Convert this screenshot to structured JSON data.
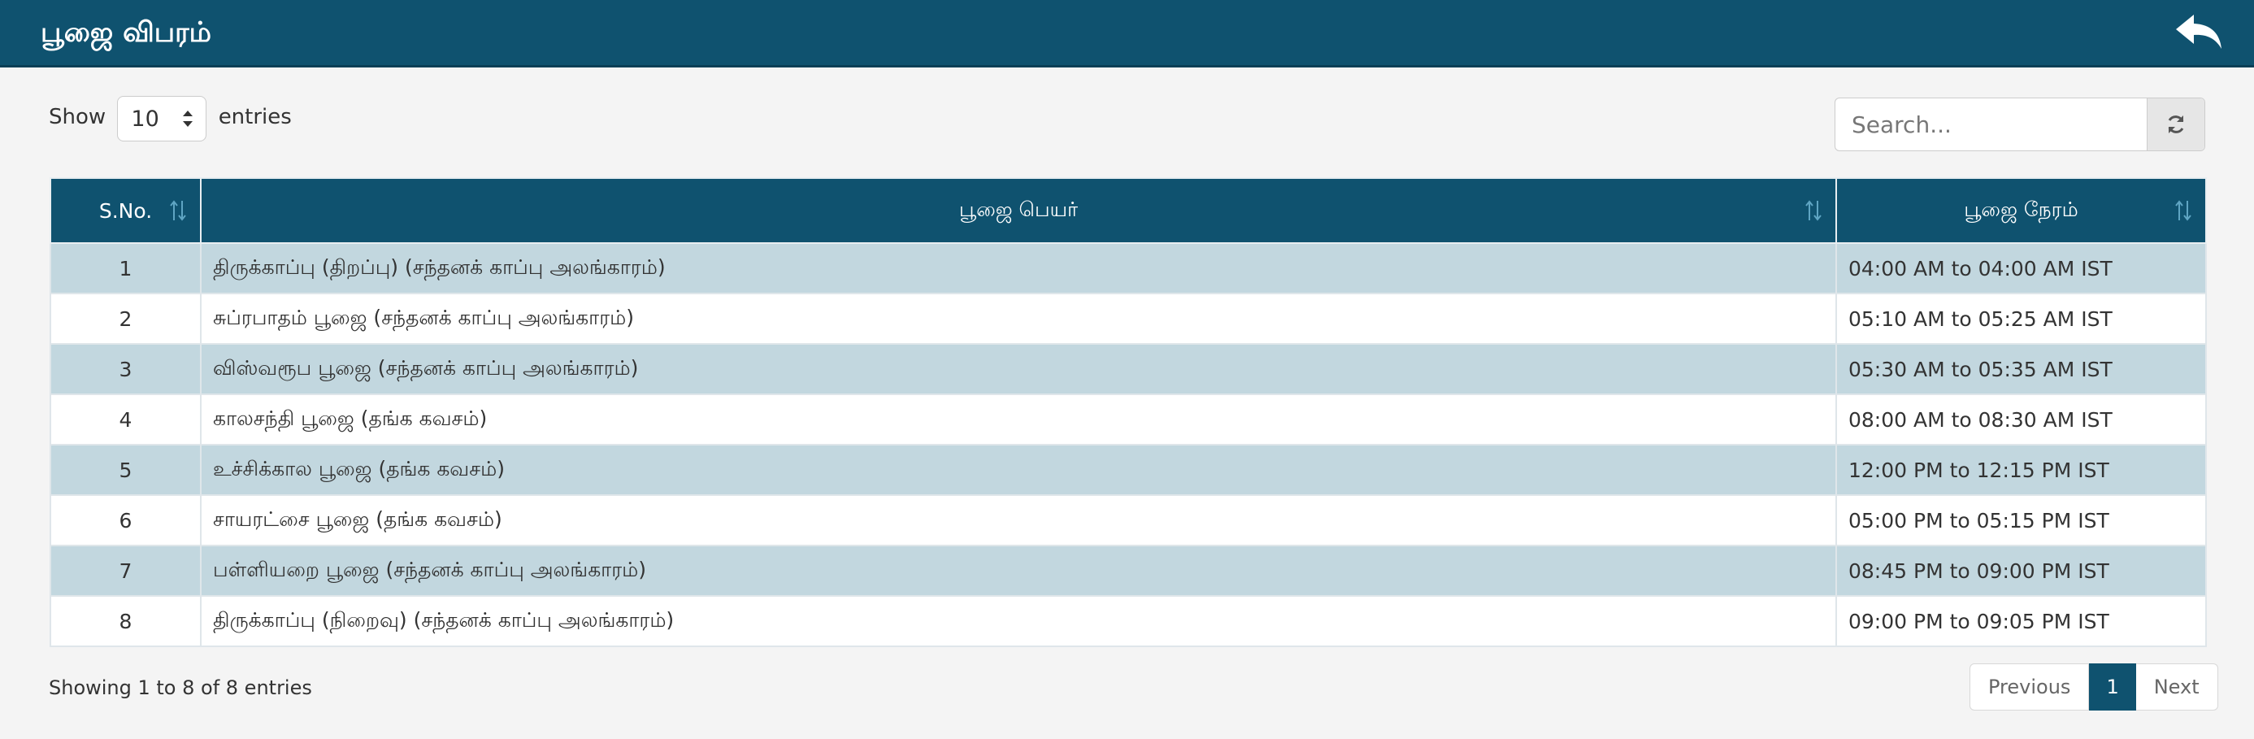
{
  "header": {
    "title": "பூஜை விபரம்",
    "back_icon": "reply-arrow-icon"
  },
  "length_control": {
    "show_label": "Show",
    "selected": "10",
    "entries_label": "entries"
  },
  "search": {
    "placeholder": "Search...",
    "value": "",
    "refresh_icon": "refresh-icon"
  },
  "table": {
    "columns": [
      "S.No.",
      "பூஜை பெயர்",
      "பூஜை நேரம்"
    ],
    "rows": [
      {
        "sno": "1",
        "name": "திருக்காப்பு (திறப்பு) (சந்தனக் காப்பு அலங்காரம்)",
        "time": "04:00 AM to 04:00 AM IST"
      },
      {
        "sno": "2",
        "name": "சுப்ரபாதம் பூஜை (சந்தனக் காப்பு அலங்காரம்)",
        "time": "05:10 AM to 05:25 AM IST"
      },
      {
        "sno": "3",
        "name": "விஸ்வரூப பூஜை (சந்தனக் காப்பு அலங்காரம்)",
        "time": "05:30 AM to 05:35 AM IST"
      },
      {
        "sno": "4",
        "name": "காலசந்தி பூஜை (தங்க கவசம்)",
        "time": "08:00 AM to 08:30 AM IST"
      },
      {
        "sno": "5",
        "name": "உச்சிக்கால பூஜை (தங்க கவசம்)",
        "time": "12:00 PM to 12:15 PM IST"
      },
      {
        "sno": "6",
        "name": "சாயரட்சை பூஜை (தங்க கவசம்)",
        "time": "05:00 PM to 05:15 PM IST"
      },
      {
        "sno": "7",
        "name": "பள்ளியறை பூஜை (சந்தனக் காப்பு அலங்காரம்)",
        "time": "08:45 PM to 09:00 PM IST"
      },
      {
        "sno": "8",
        "name": "திருக்காப்பு (நிறைவு) (சந்தனக் காப்பு அலங்காரம்)",
        "time": "09:00 PM to 09:05 PM IST"
      }
    ]
  },
  "footer": {
    "info": "Showing 1 to 8 of 8 entries"
  },
  "pagination": {
    "previous": "Previous",
    "current": "1",
    "next": "Next"
  },
  "colors": {
    "primary": "#0f526f",
    "odd_row": "#c2d7df",
    "page_bg": "#f4f4f4"
  }
}
